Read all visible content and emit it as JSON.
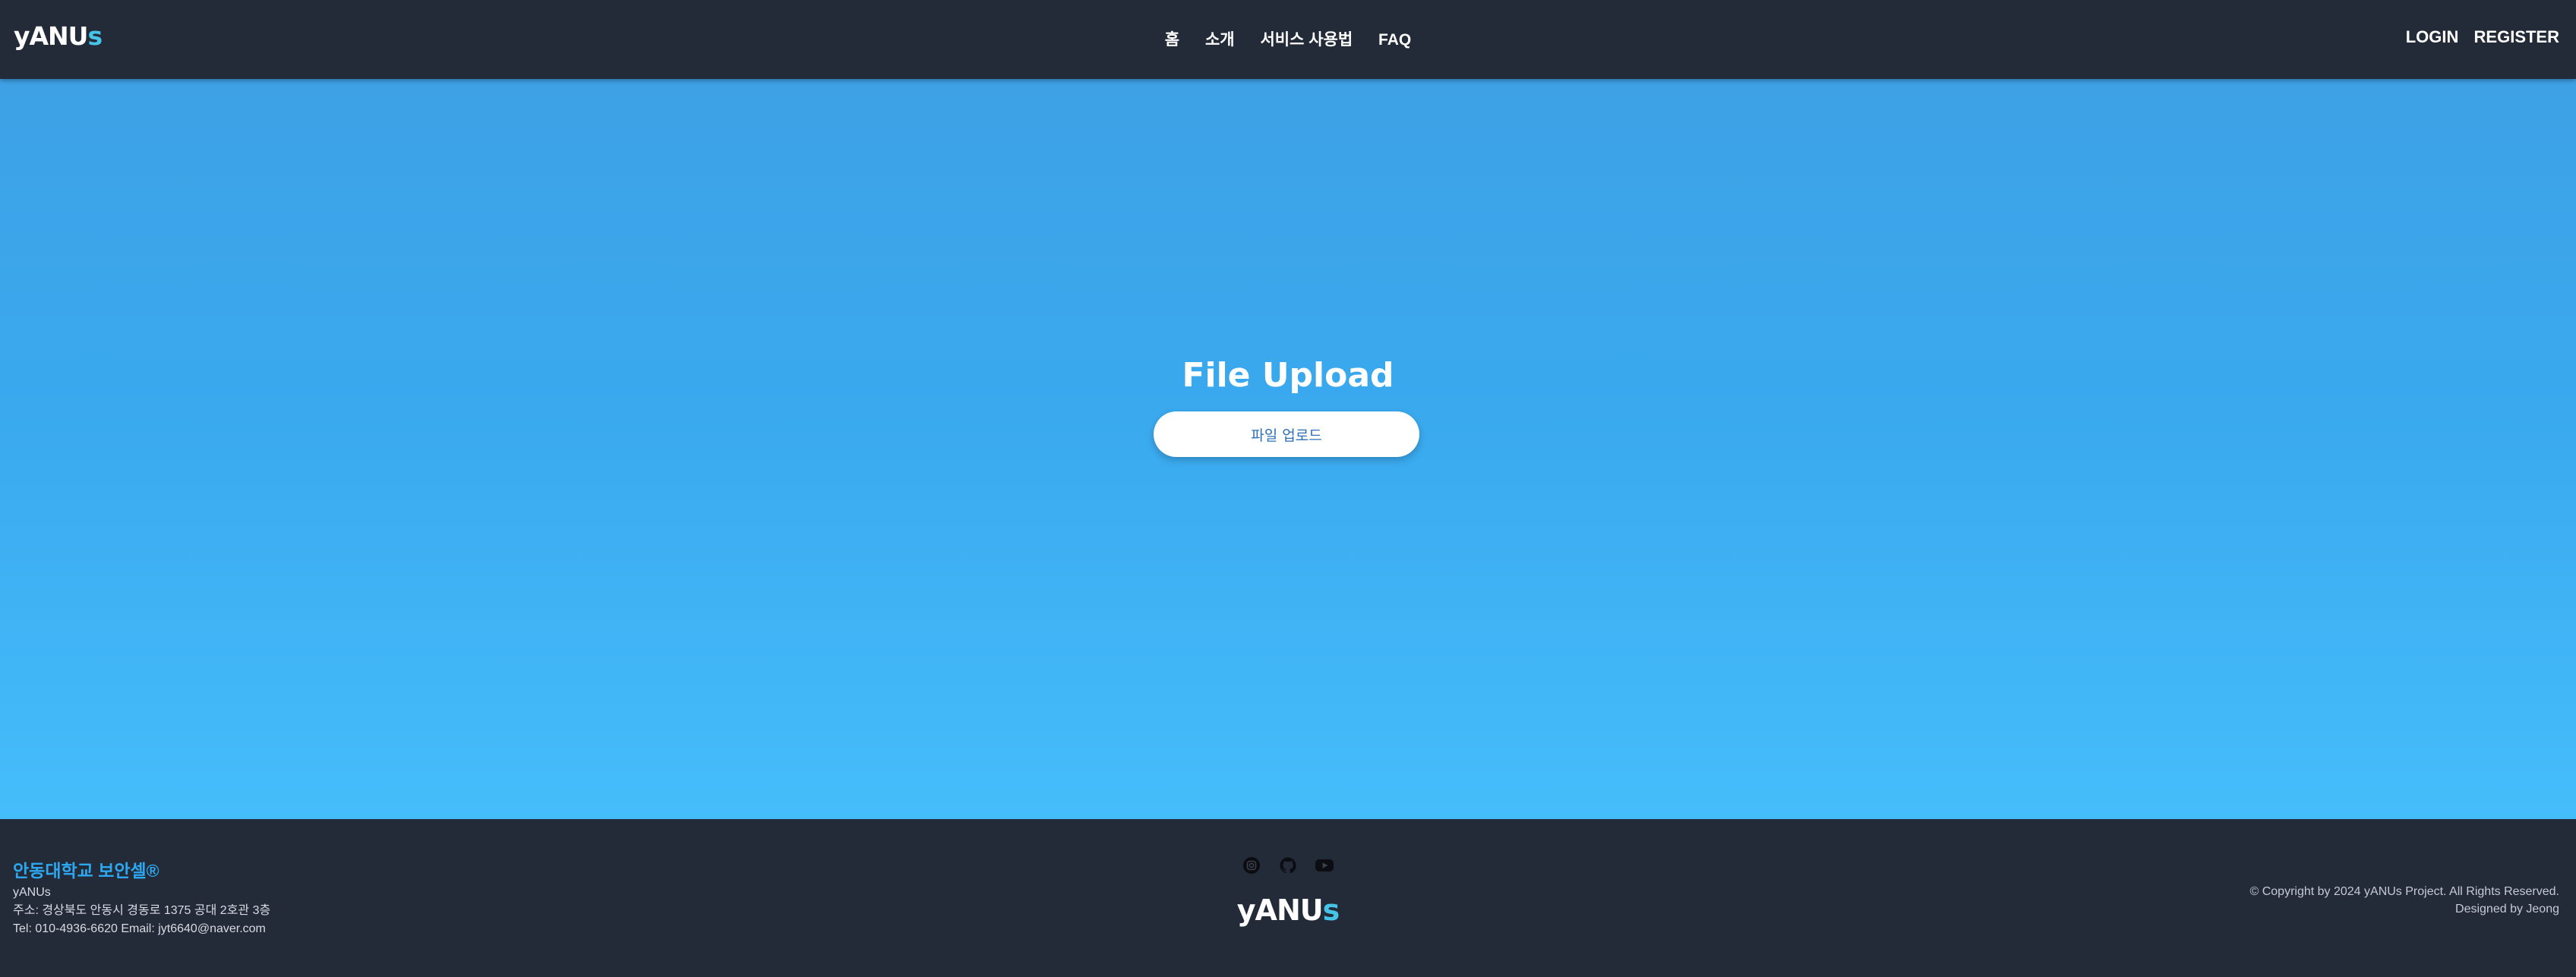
{
  "header": {
    "logo": {
      "main": "yANU",
      "accent": "s"
    },
    "nav": [
      {
        "label": "홈"
      },
      {
        "label": "소개"
      },
      {
        "label": "서비스 사용법"
      },
      {
        "label": "FAQ"
      }
    ],
    "auth": {
      "login": "LOGIN",
      "register": "REGISTER"
    }
  },
  "hero": {
    "title": "File Upload",
    "upload_button": "파일 업로드"
  },
  "footer": {
    "brand": "안동대학교 보안셀®",
    "org": "yANUs",
    "address": "주소: 경상북도 안동시 경동로 1375 공대 2호관 3층",
    "contact": "Tel: 010-4936-6620 Email: jyt6640@naver.com",
    "socials": [
      "instagram-icon",
      "github-icon",
      "youtube-icon"
    ],
    "logo": {
      "main": "yANU",
      "accent": "s"
    },
    "copyright": "© Copyright by 2024 yANUs Project. All Rights Reserved.",
    "designer": "Designed by Jeong"
  },
  "colors": {
    "header_bg": "#232b38",
    "hero_top": "#3ea1e6",
    "hero_bottom": "#45bdfb",
    "brand_blue": "#2da8f0",
    "logo_accent": "#46c4e8"
  }
}
